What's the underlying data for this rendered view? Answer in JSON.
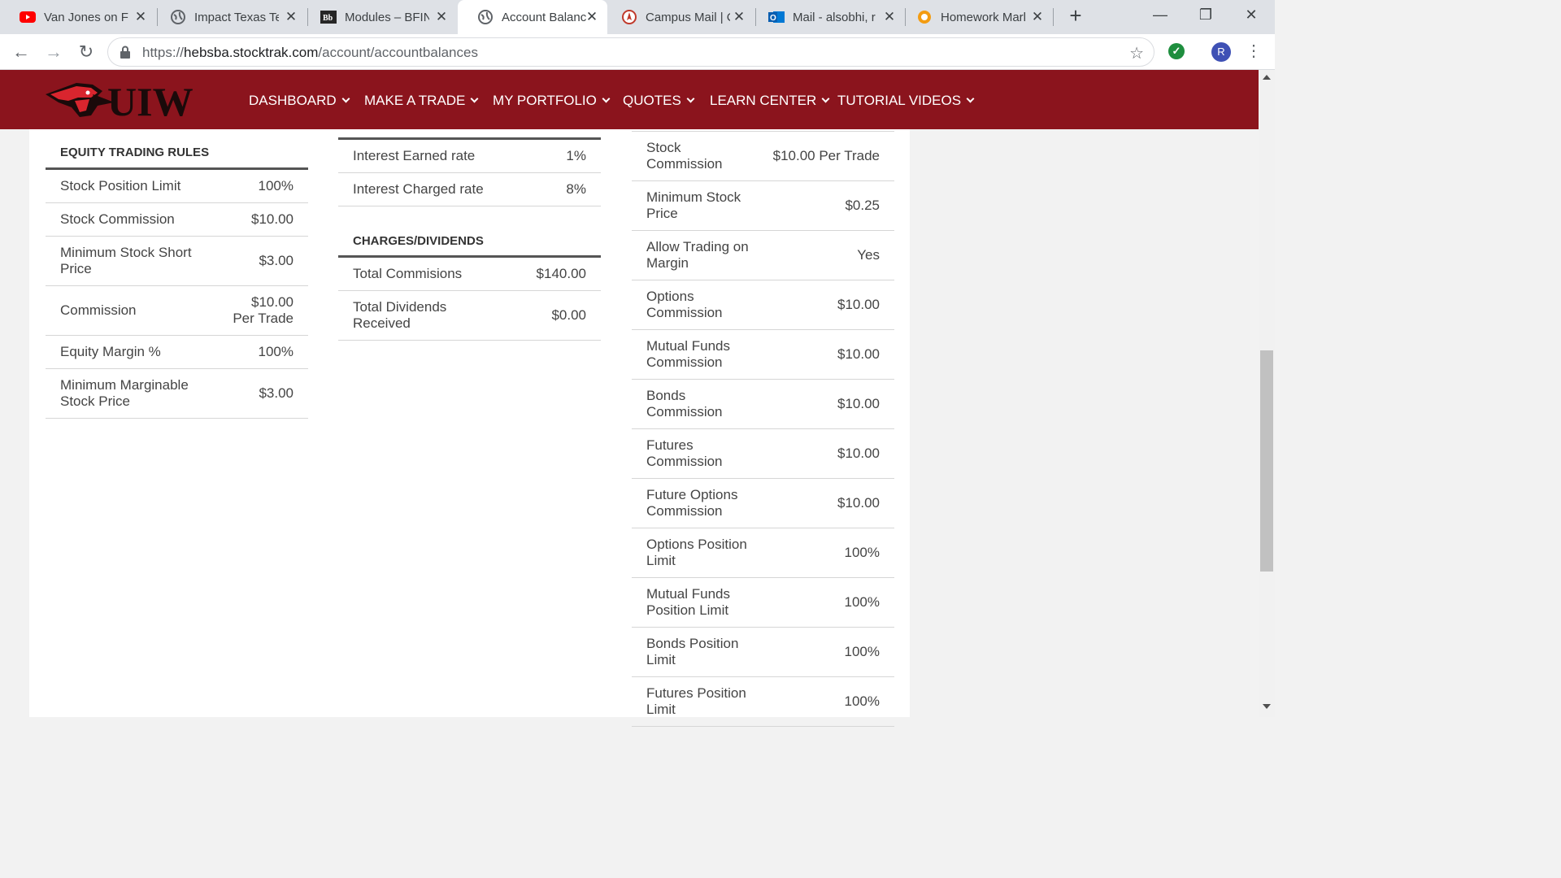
{
  "browser": {
    "tabs": [
      {
        "title": "Van Jones on Fox",
        "icon": "youtube-icon"
      },
      {
        "title": "Impact Texas Tee",
        "icon": "globe-icon"
      },
      {
        "title": "Modules – BFIN",
        "icon": "blackboard-icon"
      },
      {
        "title": "Account Balance",
        "icon": "globe-icon",
        "active": true
      },
      {
        "title": "Campus Mail | C",
        "icon": "campus-mail-icon"
      },
      {
        "title": "Mail - alsobhi, r",
        "icon": "outlook-icon"
      },
      {
        "title": "Homework Mark",
        "icon": "homework-icon"
      }
    ],
    "new_tab": "+",
    "url_prefix": "https://",
    "url_host": "hebsba.stocktrak.com",
    "url_path": "/account/accountbalances",
    "profile_initial": "R"
  },
  "site": {
    "logo_text": "UIW",
    "brand_color": "#8b141d",
    "nav": [
      "DASHBOARD",
      "MAKE A TRADE",
      "MY PORTFOLIO",
      "QUOTES",
      "LEARN CENTER",
      "TUTORIAL VIDEOS"
    ]
  },
  "equity_rules": {
    "heading": "EQUITY TRADING RULES",
    "rows": [
      {
        "label": "Stock Position Limit",
        "value": "100%"
      },
      {
        "label": "Stock Commission",
        "value": "$10.00"
      },
      {
        "label": "Minimum Stock Short Price",
        "value": "$3.00"
      },
      {
        "label": "Commission",
        "value": "$10.00 Per Trade"
      },
      {
        "label": "Equity Margin %",
        "value": "100%"
      },
      {
        "label": "Minimum Marginable Stock Price",
        "value": "$3.00"
      }
    ]
  },
  "interest": {
    "rows": [
      {
        "label": "Interest Earned rate",
        "value": "1%"
      },
      {
        "label": "Interest Charged rate",
        "value": "8%"
      }
    ]
  },
  "charges": {
    "heading": "CHARGES/DIVIDENDS",
    "rows": [
      {
        "label": "Total Commisions",
        "value": "$140.00"
      },
      {
        "label": "Total Dividends Received",
        "value": "$0.00"
      }
    ]
  },
  "trading_rules": {
    "rows": [
      {
        "label": "Stock Commission",
        "value": "$10.00 Per Trade"
      },
      {
        "label": "Minimum Stock Price",
        "value": "$0.25"
      },
      {
        "label": "Allow Trading on Margin",
        "value": "Yes"
      },
      {
        "label": "Options Commission",
        "value": "$10.00"
      },
      {
        "label": "Mutual Funds Commission",
        "value": "$10.00"
      },
      {
        "label": "Bonds Commission",
        "value": "$10.00"
      },
      {
        "label": "Futures Commission",
        "value": "$10.00"
      },
      {
        "label": "Future Options Commission",
        "value": "$10.00"
      },
      {
        "label": "Options Position Limit",
        "value": "100%"
      },
      {
        "label": "Mutual Funds Position Limit",
        "value": "100%"
      },
      {
        "label": "Bonds Position Limit",
        "value": "100%"
      },
      {
        "label": "Futures Position Limit",
        "value": "100%"
      }
    ]
  }
}
